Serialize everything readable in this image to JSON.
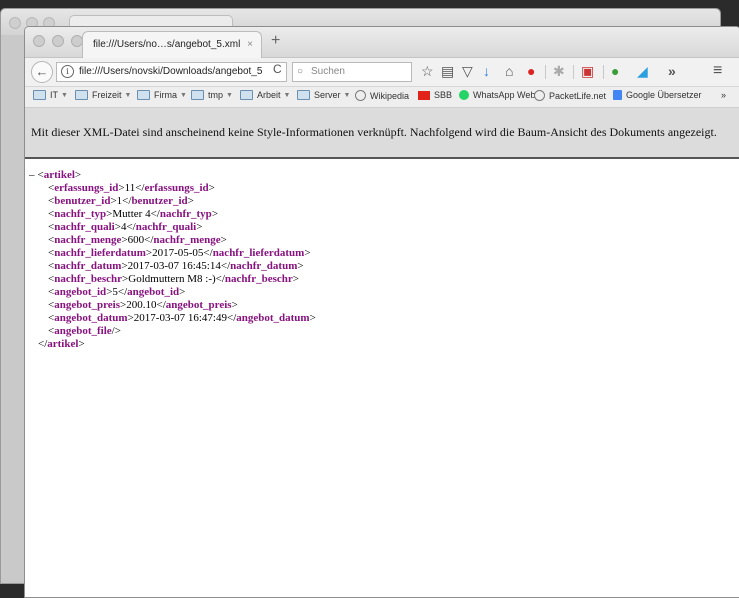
{
  "browser": {
    "tab_title": "file:///Users/no…s/angebot_5.xml",
    "tab_close": "×",
    "new_tab": "+",
    "url": "file:///Users/novski/Downloads/angebot_5",
    "search_placeholder": "Suchen",
    "overflow": "»",
    "menu": "≡"
  },
  "bookmarks": [
    {
      "label": "IT",
      "icon": "folder-icon",
      "dropdown": true
    },
    {
      "label": "Freizeit",
      "icon": "folder-icon",
      "dropdown": true
    },
    {
      "label": "Firma",
      "icon": "folder-icon",
      "dropdown": true
    },
    {
      "label": "tmp",
      "icon": "folder-icon",
      "dropdown": true
    },
    {
      "label": "Arbeit",
      "icon": "folder-icon",
      "dropdown": true
    },
    {
      "label": "Server",
      "icon": "folder-icon",
      "dropdown": true
    },
    {
      "label": "Wikipedia",
      "icon": "globe-icon"
    },
    {
      "label": "SBB",
      "icon": "sbb-icon"
    },
    {
      "label": "WhatsApp Web",
      "icon": "whatsapp-icon"
    },
    {
      "label": "PacketLife.net",
      "icon": "globe-icon"
    },
    {
      "label": "Google Übersetzer",
      "icon": "google-translate-icon"
    }
  ],
  "bookmarks_overflow": "»",
  "notice": "Mit dieser XML-Datei sind anscheinend keine Style-Informationen verknüpft. Nachfolgend wird die Baum-Ansicht des Dokuments angezeigt.",
  "xml": {
    "collapse": "–",
    "root": "artikel",
    "children": [
      {
        "tag": "erfassungs_id",
        "value": "11"
      },
      {
        "tag": "benutzer_id",
        "value": "1"
      },
      {
        "tag": "nachfr_typ",
        "value": "Mutter 4"
      },
      {
        "tag": "nachfr_quali",
        "value": "4"
      },
      {
        "tag": "nachfr_menge",
        "value": "600"
      },
      {
        "tag": "nachfr_lieferdatum",
        "value": "2017-05-05"
      },
      {
        "tag": "nachfr_datum",
        "value": "2017-03-07 16:45:14"
      },
      {
        "tag": "nachfr_beschr",
        "value": "Goldmuttern M8 :-)"
      },
      {
        "tag": "angebot_id",
        "value": "5"
      },
      {
        "tag": "angebot_preis",
        "value": "200.10"
      },
      {
        "tag": "angebot_datum",
        "value": "2017-03-07 16:47:49"
      },
      {
        "tag": "angebot_file",
        "value": null,
        "self_closing": true
      }
    ]
  },
  "colors": {
    "tag": "#881280",
    "sbb": "#e2231a",
    "whatsapp": "#25d366"
  }
}
